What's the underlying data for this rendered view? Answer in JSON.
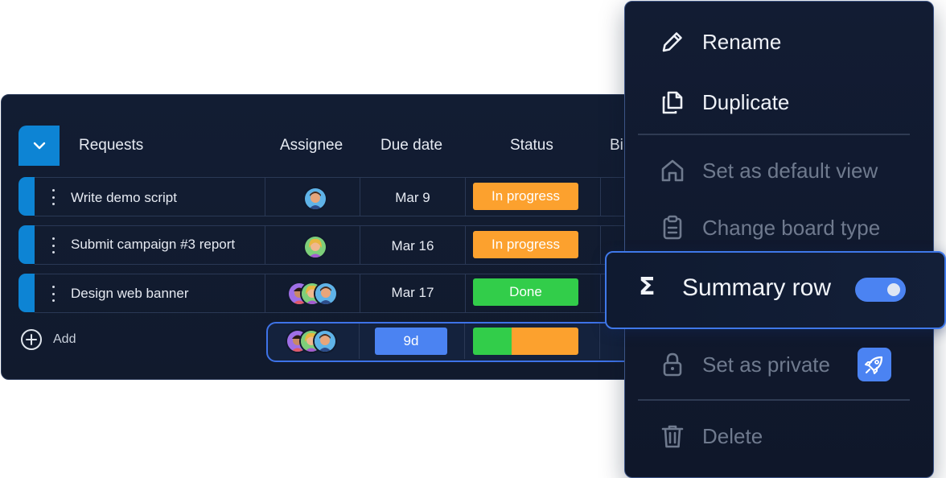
{
  "board": {
    "headers": {
      "requests": "Requests",
      "assignee": "Assignee",
      "due_date": "Due date",
      "status": "Status",
      "cut": "Bi"
    },
    "rows": [
      {
        "name": "Write demo script",
        "due": "Mar 9",
        "status": "In progress",
        "status_color": "#fca12e"
      },
      {
        "name": "Submit campaign #3 report",
        "due": "Mar 16",
        "status": "In progress",
        "status_color": "#fca12e"
      },
      {
        "name": "Design web banner",
        "due": "Mar 17",
        "status": "Done",
        "status_color": "#32cd4a"
      }
    ],
    "add_label": "Add",
    "summary": {
      "days": "9d",
      "done_fraction": 0.37
    }
  },
  "menu": {
    "items": [
      {
        "label": "Rename",
        "icon": "pencil-icon",
        "enabled": true
      },
      {
        "label": "Duplicate",
        "icon": "copy-icon",
        "enabled": true
      },
      {
        "label": "Set as default view",
        "icon": "home-icon",
        "enabled": false
      },
      {
        "label": "Change board type",
        "icon": "clipboard-icon",
        "enabled": false
      },
      {
        "label": "Summary row",
        "icon": "sigma-icon",
        "enabled": true,
        "toggle_on": true
      },
      {
        "label": "Set as private",
        "icon": "lock-icon",
        "enabled": false,
        "badge_icon": "rocket-icon"
      },
      {
        "label": "Delete",
        "icon": "trash-icon",
        "enabled": false
      }
    ]
  },
  "colors": {
    "accent_blue": "#0d84d4",
    "highlight_blue": "#4b83f2",
    "in_progress": "#fca12e",
    "done": "#32cd4a",
    "panel_bg": "#121c33"
  }
}
